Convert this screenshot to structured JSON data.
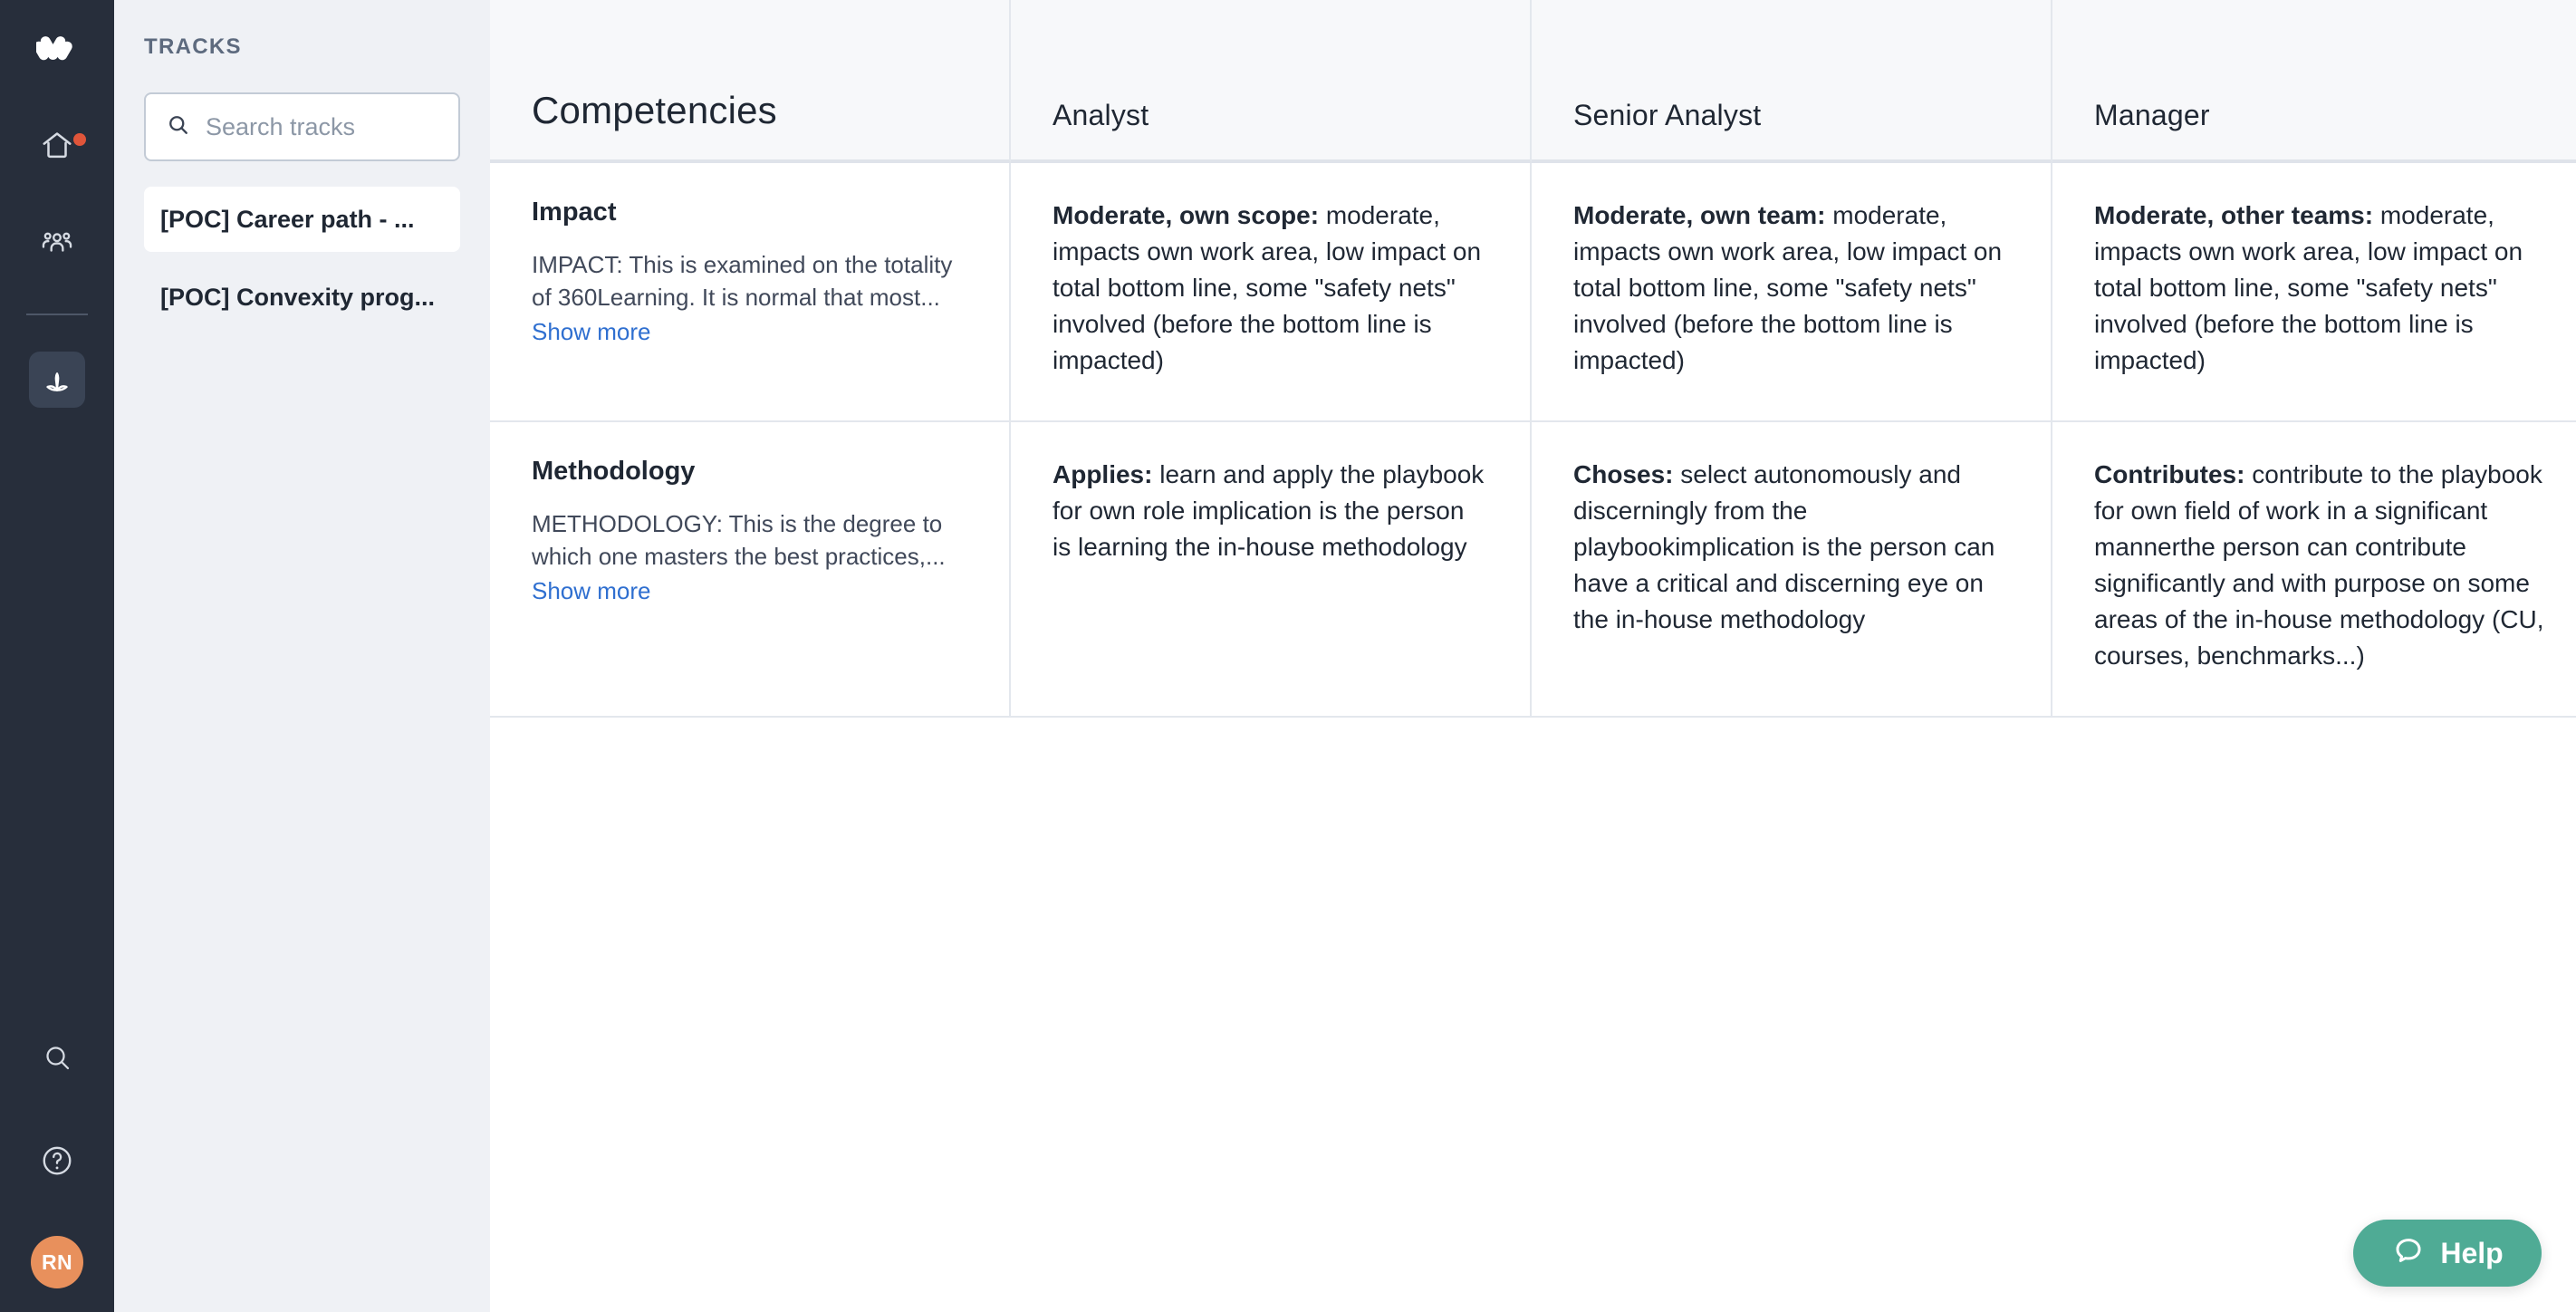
{
  "rail": {
    "logo_icon": "app-logo-icon",
    "items": [
      {
        "icon": "home-icon",
        "name": "home",
        "active": false,
        "badge": true
      },
      {
        "icon": "group-icon",
        "name": "groups",
        "active": false,
        "badge": false
      },
      {
        "icon": "sprout-icon",
        "name": "growth",
        "active": true,
        "badge": false
      }
    ],
    "bottom": [
      {
        "icon": "search-icon",
        "name": "search"
      },
      {
        "icon": "help-circle-icon",
        "name": "help"
      }
    ],
    "avatar_initials": "RN"
  },
  "tracks_panel": {
    "title": "TRACKS",
    "search": {
      "placeholder": "Search tracks",
      "value": ""
    },
    "items": [
      {
        "label": "[POC] Career path - ...",
        "selected": true
      },
      {
        "label": "[POC] Convexity prog...",
        "selected": false
      }
    ]
  },
  "table": {
    "headers": [
      "Competencies",
      "Analyst",
      "Senior Analyst",
      "Manager"
    ],
    "show_more_label": "Show more",
    "rows": [
      {
        "competency": {
          "name": "Impact",
          "description": "IMPACT: This is examined on the totality of 360Learning. It is normal that most..."
        },
        "levels": [
          {
            "lead": "Moderate, own scope:",
            "body": " moderate, impacts own work area, low impact on total bottom line, some \"safety nets\" involved (before the bottom line is impacted)"
          },
          {
            "lead": "Moderate, own team:",
            "body": " moderate, impacts own work area, low impact on total bottom line, some \"safety nets\" involved (before the bottom line is impacted)"
          },
          {
            "lead": "Moderate, other teams:",
            "body": " moderate, impacts own work area, low impact on total bottom line, some \"safety nets\" involved (before the bottom line is impacted)"
          }
        ]
      },
      {
        "competency": {
          "name": "Methodology",
          "description": "METHODOLOGY: This is the degree to which one masters the best practices,..."
        },
        "levels": [
          {
            "lead": "Applies:",
            "body": " learn and apply the playbook for own role implication is the person is learning the in-house methodology"
          },
          {
            "lead": "Choses:",
            "body": " select autonomously and discerningly from the playbookimplication is the person can have a critical and discerning eye on the in-house methodology"
          },
          {
            "lead": "Contributes:",
            "body": " contribute to the playbook for own field of work in a significant mannerthe person can contribute significantly and with purpose on some areas of the in-house methodology (CU, courses, benchmarks...)"
          }
        ]
      }
    ]
  },
  "help_widget": {
    "label": "Help",
    "icon": "chat-bubble-icon",
    "color": "#4fab95"
  }
}
